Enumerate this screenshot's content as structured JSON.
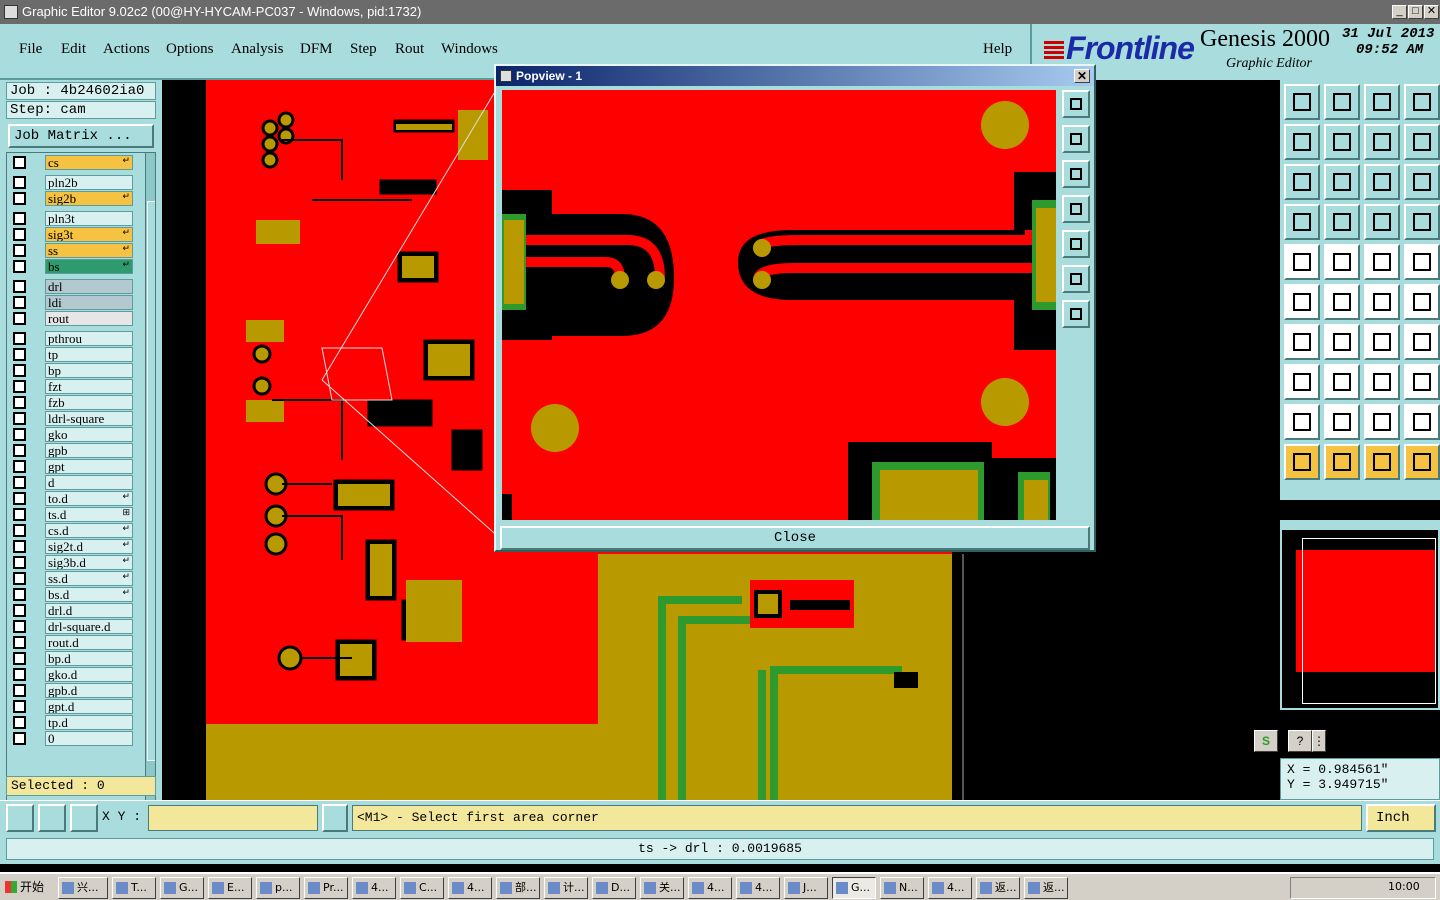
{
  "window": {
    "title": "Graphic Editor 9.02c2 (00@HY-HYCAM-PC037 - Windows, pid:1732)",
    "minimize": "_",
    "maximize": "□",
    "close": "✕"
  },
  "menu": [
    "File",
    "Edit",
    "Actions",
    "Options",
    "Analysis",
    "DFM",
    "Step",
    "Rout",
    "Windows"
  ],
  "help": "Help",
  "brand": {
    "logo": "Frontline",
    "product": "Genesis 2000",
    "subtitle": "Graphic Editor",
    "date": "31 Jul 2013",
    "time": "09:52 AM"
  },
  "job": {
    "job_line": "Job : 4b24602ia0",
    "step_line": "Step: cam",
    "job_matrix": "Job Matrix ..."
  },
  "layers": [
    {
      "name": "cs",
      "color": "#f5c242",
      "flag": "↵"
    },
    {
      "name": "pln2b",
      "color": "#d8f0f0",
      "flag": ""
    },
    {
      "name": "sig2b",
      "color": "#f5c242",
      "flag": "↵"
    },
    {
      "name": "pln3t",
      "color": "#d8f0f0",
      "flag": ""
    },
    {
      "name": "sig3t",
      "color": "#f5c242",
      "flag": "↵"
    },
    {
      "name": "ss",
      "color": "#f5c242",
      "flag": "↵"
    },
    {
      "name": "bs",
      "color": "#2e9a6e",
      "flag": "↵"
    },
    {
      "name": "drl",
      "color": "#b4c8d0",
      "flag": ""
    },
    {
      "name": "ldi",
      "color": "#b4c8d0",
      "flag": ""
    },
    {
      "name": "rout",
      "color": "#e6e6e6",
      "flag": ""
    },
    {
      "name": "pthrou",
      "color": "#d8f0f0",
      "flag": ""
    },
    {
      "name": "tp",
      "color": "#d8f0f0",
      "flag": ""
    },
    {
      "name": "bp",
      "color": "#d8f0f0",
      "flag": ""
    },
    {
      "name": "fzt",
      "color": "#d8f0f0",
      "flag": ""
    },
    {
      "name": "fzb",
      "color": "#d8f0f0",
      "flag": ""
    },
    {
      "name": "ldrl-square",
      "color": "#d8f0f0",
      "flag": ""
    },
    {
      "name": "gko",
      "color": "#d8f0f0",
      "flag": ""
    },
    {
      "name": "gpb",
      "color": "#d8f0f0",
      "flag": ""
    },
    {
      "name": "gpt",
      "color": "#d8f0f0",
      "flag": ""
    },
    {
      "name": "d",
      "color": "#d8f0f0",
      "flag": ""
    },
    {
      "name": "to.d",
      "color": "#d8f0f0",
      "flag": "↵"
    },
    {
      "name": "ts.d",
      "color": "#d8f0f0",
      "flag": "⊞"
    },
    {
      "name": "cs.d",
      "color": "#d8f0f0",
      "flag": "↵"
    },
    {
      "name": "sig2t.d",
      "color": "#d8f0f0",
      "flag": "↵"
    },
    {
      "name": "sig3b.d",
      "color": "#d8f0f0",
      "flag": "↵"
    },
    {
      "name": "ss.d",
      "color": "#d8f0f0",
      "flag": "↵"
    },
    {
      "name": "bs.d",
      "color": "#d8f0f0",
      "flag": "↵"
    },
    {
      "name": "drl.d",
      "color": "#d8f0f0",
      "flag": ""
    },
    {
      "name": "drl-square.d",
      "color": "#d8f0f0",
      "flag": ""
    },
    {
      "name": "rout.d",
      "color": "#d8f0f0",
      "flag": ""
    },
    {
      "name": "bp.d",
      "color": "#d8f0f0",
      "flag": ""
    },
    {
      "name": "gko.d",
      "color": "#d8f0f0",
      "flag": ""
    },
    {
      "name": "gpb.d",
      "color": "#d8f0f0",
      "flag": ""
    },
    {
      "name": "gpt.d",
      "color": "#d8f0f0",
      "flag": ""
    },
    {
      "name": "tp.d",
      "color": "#d8f0f0",
      "flag": ""
    },
    {
      "name": "0",
      "color": "#d8f0f0",
      "flag": ""
    }
  ],
  "selected": "Selected : 0",
  "popview": {
    "title": "Popview - 1",
    "close_label": "Close"
  },
  "coords": {
    "x": "X = 0.984561\"",
    "y": "Y = 3.949715\""
  },
  "command": {
    "xy_label": "X Y :",
    "xy_value": "",
    "prompt": "<M1> - Select first area corner",
    "unit": "Inch"
  },
  "status": "ts -> drl : 0.0019685",
  "taskbar": {
    "start": "开始",
    "items": [
      "兴...",
      "T...",
      "G...",
      "E...",
      "p...",
      "Pr...",
      "4...",
      "C...",
      "4...",
      "部...",
      "计...",
      "D...",
      "关...",
      "4...",
      "4...",
      "J...",
      "G...",
      "N...",
      "4...",
      "返...",
      "返..."
    ],
    "clock": "10:00"
  }
}
